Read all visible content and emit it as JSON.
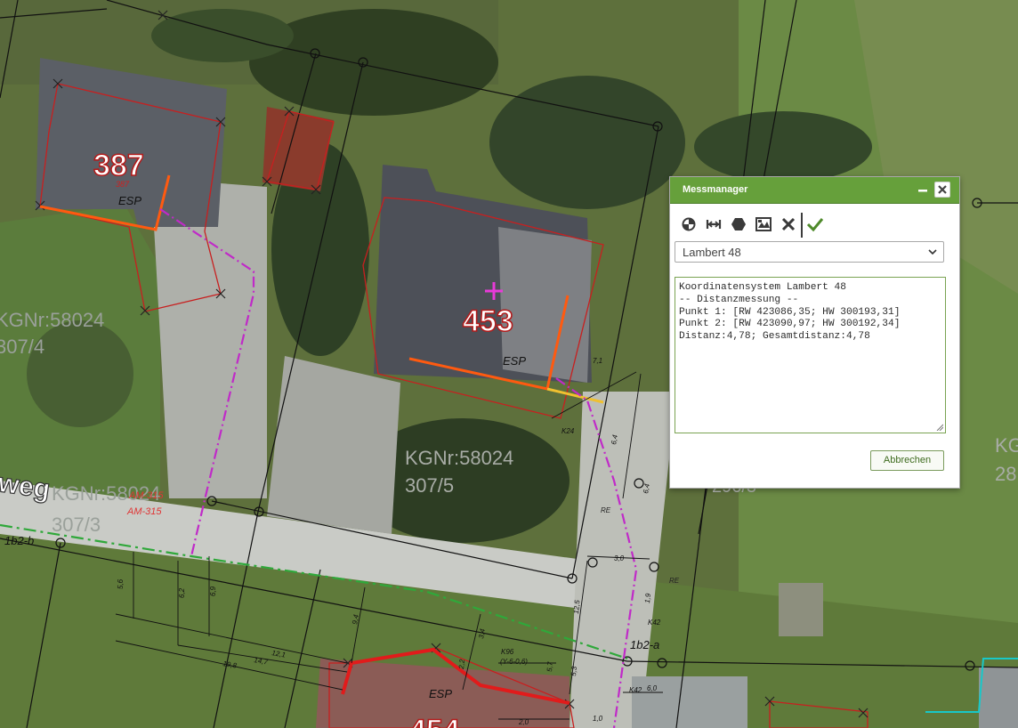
{
  "map": {
    "parcel_labels": [
      {
        "number": "387",
        "sub": "387"
      },
      {
        "number": "453"
      },
      {
        "number": "454"
      }
    ],
    "kg_labels": [
      {
        "line1": "KGNr:58024",
        "line2": "307/4"
      },
      {
        "line1": "KGNr:58024",
        "line2": "307/5"
      },
      {
        "line1": "KGNr:58024",
        "line2": "307/3"
      },
      {
        "line1": "KG",
        "line2": "28"
      },
      {
        "line2": "296/3"
      }
    ],
    "street_label": "weg",
    "esp_labels": [
      "ESP",
      "ESP",
      "ESP"
    ],
    "point_codes": [
      "K24",
      "K42",
      "K42",
      "K96",
      "(Y-6-0,6)",
      "AM-315",
      "AM-315",
      "RE",
      "RE",
      "1b2-a",
      "1b2-b"
    ],
    "dimensions": [
      "7,1",
      "6,4",
      "6,4",
      "5,6",
      "6,2",
      "6,9",
      "9,4",
      "3,4",
      "12,1",
      "14,7",
      "19,8",
      "12,5",
      "5,7",
      "5,3",
      "2,2",
      "3,0",
      "1,9",
      "6,0",
      "2,0",
      "1,0"
    ]
  },
  "panel": {
    "title": "Messmanager",
    "tools": [
      "globe-tool-icon",
      "distance-tool-icon",
      "area-tool-icon",
      "export-tool-icon",
      "delete-tool-icon",
      "confirm-tool-icon"
    ],
    "coordinate_system": "Lambert 48",
    "output_lines": [
      "Koordinatensystem Lambert 48",
      "",
      "-- Distanzmessung --",
      "Punkt 1: [RW 423086,35; HW 300193,31]",
      "Punkt 2: [RW 423090,97; HW 300192,34]",
      "Distanz:4,78; Gesamtdistanz:4,78"
    ],
    "cancel_label": "Abbrechen"
  },
  "colors": {
    "panel_header": "#66a03b",
    "panel_accent": "#3e6b1e",
    "parcel_line": "#c81f1f",
    "building_edge": "#ff5a10",
    "pipe_line": "#c02ac8",
    "green_line": "#2fa83a",
    "measure_cross": "#e83ad8"
  }
}
